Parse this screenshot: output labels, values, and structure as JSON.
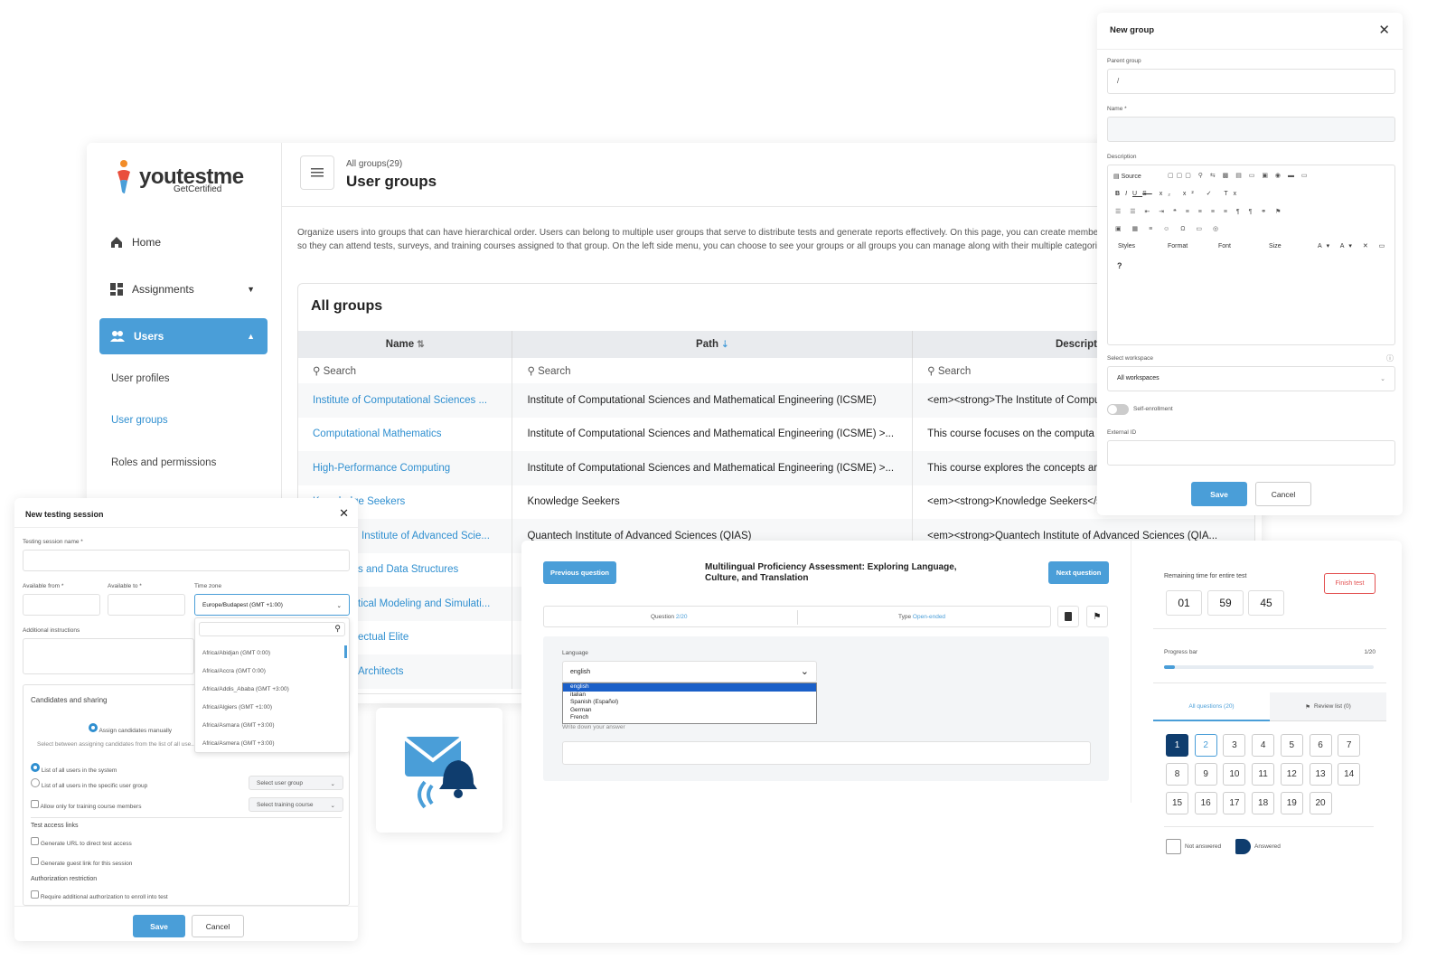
{
  "logo": {
    "brand": "youtestme",
    "tagline": "GetCertified"
  },
  "sidebar": {
    "items": [
      {
        "label": "Home",
        "icon": "home-icon"
      },
      {
        "label": "Assignments",
        "icon": "dashboard-icon"
      },
      {
        "label": "Users",
        "icon": "users-icon"
      }
    ],
    "sub_items": [
      "User profiles",
      "User groups",
      "Roles and permissions"
    ]
  },
  "header": {
    "breadcrumb": "All groups(29)",
    "title": "User groups"
  },
  "intro": "Organize users into groups that can have hierarchical order. Users can belong to multiple user groups that serve to distribute tests and generate reports effectively. On this page, you can create members so they can attend tests, surveys, and training courses assigned to that group. On the left side menu, you can choose to see your groups or all groups you can manage along with their multiple categories.",
  "groups": {
    "title": "All groups",
    "columns": [
      "Name",
      "Path",
      "Description"
    ],
    "search": "Search",
    "rows": [
      {
        "name": "Institute of Computational Sciences ...",
        "path": "Institute of Computational Sciences and Mathematical Engineering (ICSME)",
        "desc": "<em><strong>The Institute of Compu"
      },
      {
        "name": "Computational Mathematics",
        "path": "Institute of Computational Sciences and Mathematical Engineering (ICSME) >...",
        "desc": "This course focuses on the computa"
      },
      {
        "name": "High-Performance Computing",
        "path": "Institute of Computational Sciences and Mathematical Engineering (ICSME) >...",
        "desc": "This course explores the concepts ar"
      },
      {
        "name": "Knowledge Seekers",
        "path": "Knowledge Seekers",
        "desc": "<em><strong>Knowledge Seekers</s"
      },
      {
        "name": "Institute of Advanced Scie...",
        "path": "Quantech Institute of Advanced Sciences (QIAS)",
        "desc": "<em><strong>Quantech Institute of Advanced Sciences (QIA..."
      },
      {
        "name": "s and Data Structures",
        "path": "",
        "desc": ""
      },
      {
        "name": "tical Modeling and Simulati...",
        "path": "",
        "desc": ""
      },
      {
        "name": "ectual Elite",
        "path": "",
        "desc": ""
      },
      {
        "name": "Architects",
        "path": "",
        "desc": ""
      }
    ]
  },
  "new_group": {
    "title": "New group",
    "parent_label": "Parent group",
    "parent_value": "/",
    "name_label": "Name *",
    "desc_label": "Description",
    "toolbar": {
      "source": "Source",
      "styles": "Styles",
      "format": "Format",
      "font": "Font",
      "size": "Size"
    },
    "workspace_label": "Select workspace",
    "workspace_value": "All workspaces",
    "self_enrollment": "Self-enrollment",
    "external_id": "External ID",
    "save": "Save",
    "cancel": "Cancel"
  },
  "session": {
    "title": "New testing session",
    "name_label": "Testing session name *",
    "from_label": "Available from *",
    "to_label": "Available to *",
    "tz_label": "Time zone",
    "tz_value": "Europe/Budapest (GMT +1:00)",
    "tz_options": [
      "Africa/Abidjan (GMT 0:00)",
      "Africa/Accra (GMT 0:00)",
      "Africa/Addis_Ababa (GMT +3:00)",
      "Africa/Algiers (GMT +1:00)",
      "Africa/Asmara (GMT +3:00)",
      "Africa/Asmera (GMT +3:00)"
    ],
    "instr_label": "Additional instructions",
    "cand_title": "Candidates and sharing",
    "assign_manual": "Assign candidates manually",
    "assign_desc": "Select between assigning candidates from the list of all use... created, you can manually assign c...",
    "opt_all": "List of all users in the system",
    "opt_group": "List of all users in the specific user group",
    "opt_course": "Allow only for training course members",
    "select_group": "Select user group",
    "select_course": "Select training course",
    "access_title": "Test access links",
    "gen_url": "Generate URL to direct test access",
    "gen_guest": "Generate guest link for this session",
    "auth_title": "Authorization restriction",
    "auth_req": "Require additional authorization to enroll into test",
    "save": "Save",
    "cancel": "Cancel"
  },
  "test": {
    "prev": "Previous question",
    "next": "Next question",
    "title": "Multilingual Proficiency Assessment: Exploring Language, Culture, and Translation",
    "question_label": "Question",
    "question_value": "2/20",
    "type_label": "Type",
    "type_value": "Open-ended",
    "language_label": "Language",
    "language_value": "english",
    "language_options": [
      "english",
      "italian",
      "Spanish (Español)",
      "German",
      "French"
    ],
    "answer_placeholder": "Write down your answer",
    "remaining_label": "Remaining time for entire test",
    "time": [
      "01",
      "59",
      "45"
    ],
    "finish": "Finish test",
    "progress_label": "Progress bar",
    "progress_value": "1/20",
    "progress_fraction": 0.05,
    "tab_all": "All questions (20)",
    "tab_review": "Review list (0)",
    "numbers": [
      "1",
      "2",
      "3",
      "4",
      "5",
      "6",
      "7",
      "8",
      "9",
      "10",
      "11",
      "12",
      "13",
      "14",
      "15",
      "16",
      "17",
      "18",
      "19",
      "20"
    ],
    "legend_not": "Not answered",
    "legend_ans": "Answered"
  },
  "colors": {
    "accent": "#4a9ed8",
    "navy": "#0f3d6e",
    "danger": "#e35050"
  }
}
